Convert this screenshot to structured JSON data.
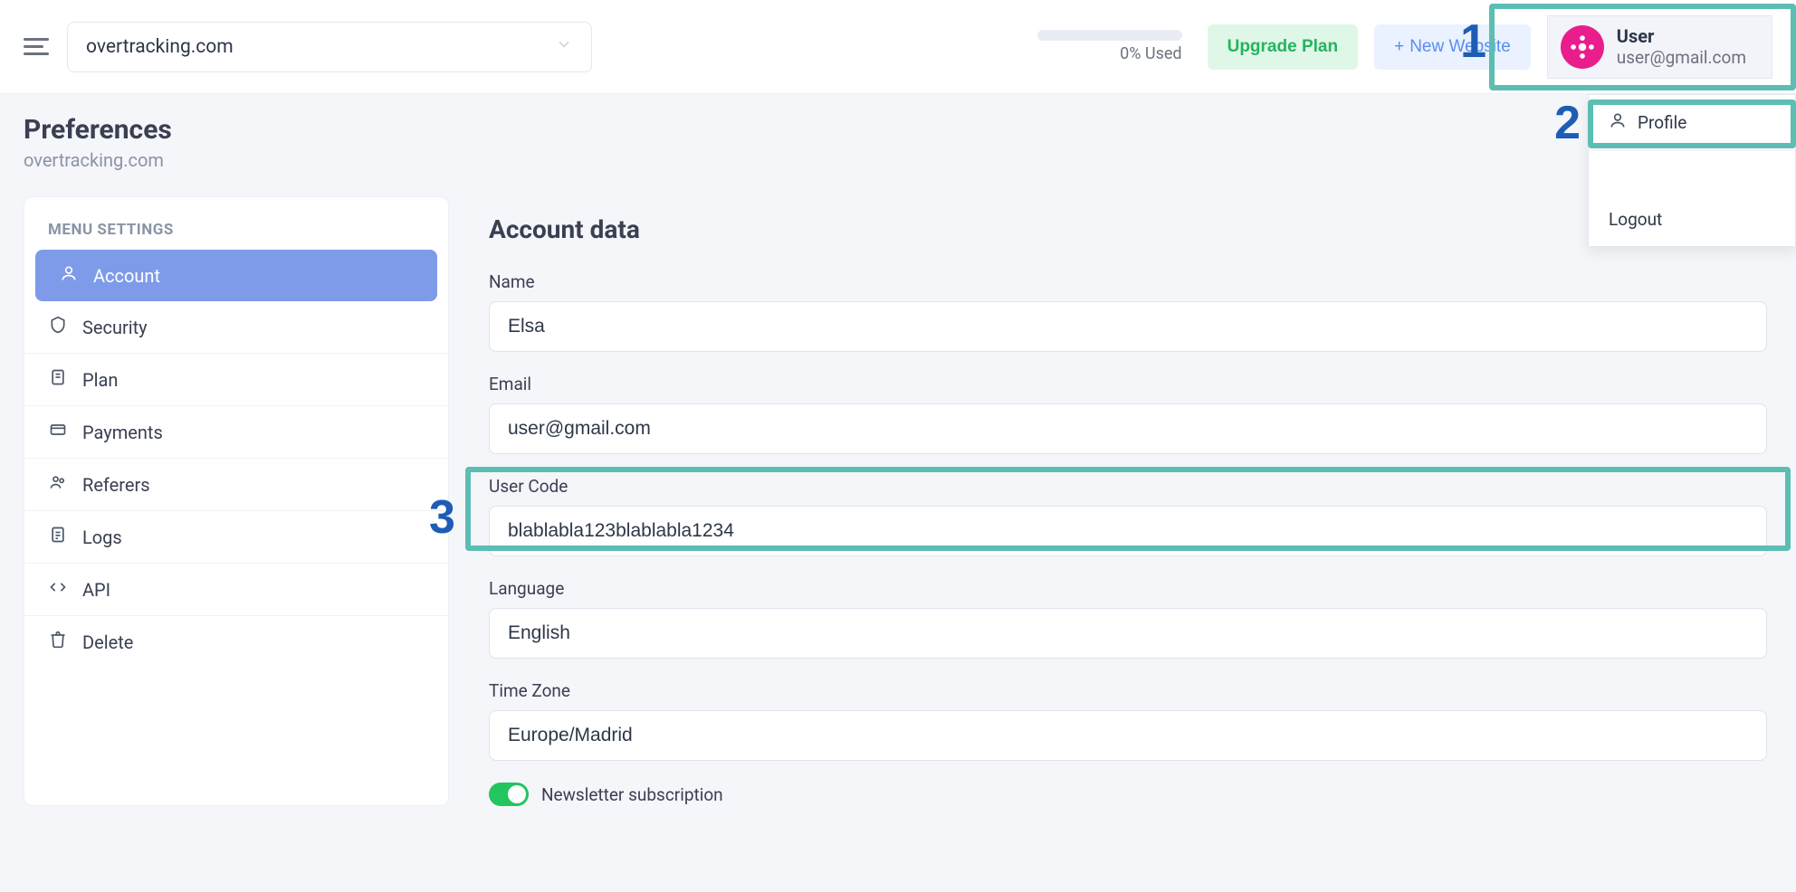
{
  "topbar": {
    "site": "overtracking.com",
    "usage_text": "0% Used",
    "upgrade_label": "Upgrade Plan",
    "new_website_label": "New Website"
  },
  "user": {
    "name": "User",
    "email": "user@gmail.com"
  },
  "dropdown": {
    "profile": "Profile",
    "logout": "Logout"
  },
  "page": {
    "title": "Preferences",
    "subtitle": "overtracking.com"
  },
  "sidebar": {
    "header": "MENU SETTINGS",
    "items": [
      {
        "label": "Account"
      },
      {
        "label": "Security"
      },
      {
        "label": "Plan"
      },
      {
        "label": "Payments"
      },
      {
        "label": "Referers"
      },
      {
        "label": "Logs"
      },
      {
        "label": "API"
      },
      {
        "label": "Delete"
      }
    ]
  },
  "form": {
    "heading": "Account data",
    "name_label": "Name",
    "name_value": "Elsa",
    "email_label": "Email",
    "email_value": "user@gmail.com",
    "usercode_label": "User Code",
    "usercode_value": "blablabla123blablabla1234",
    "language_label": "Language",
    "language_value": "English",
    "timezone_label": "Time Zone",
    "timezone_value": "Europe/Madrid",
    "newsletter_label": "Newsletter subscription"
  },
  "annotations": {
    "one": "1",
    "two": "2",
    "three": "3"
  }
}
